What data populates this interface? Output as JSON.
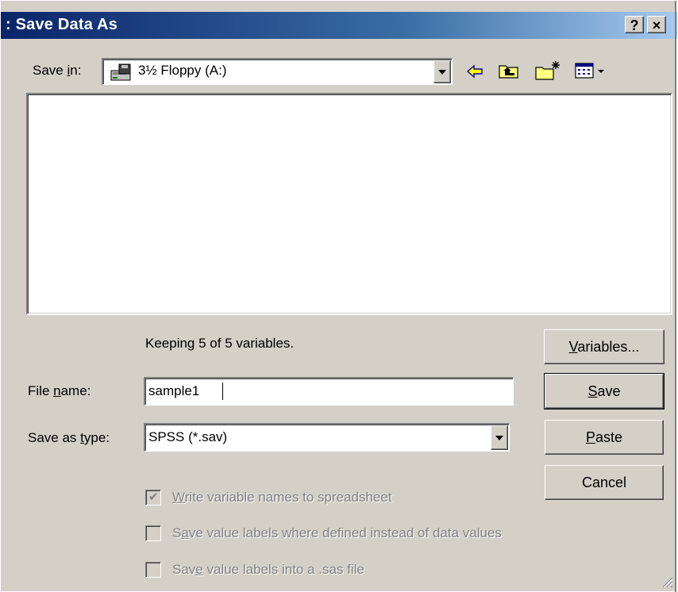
{
  "window": {
    "title": ": Save Data As",
    "help_button": "?",
    "close_button": "×"
  },
  "save_in": {
    "label_pre": "Save ",
    "label_u": "i",
    "label_post": "n:",
    "value": "3½ Floppy (A:)",
    "icon": "floppy-drive-icon"
  },
  "toolbar": {
    "icons": [
      "back-arrow-icon",
      "up-folder-icon",
      "new-folder-icon",
      "view-menu-icon"
    ]
  },
  "status": {
    "keeping": "Keeping 5 of 5 variables."
  },
  "file_name": {
    "label_pre": "File ",
    "label_u": "n",
    "label_post": "ame:",
    "value": "sample1"
  },
  "save_type": {
    "label_pre": "Save as ",
    "label_u": "t",
    "label_post": "ype:",
    "value": "SPSS (*.sav)"
  },
  "buttons": {
    "variables_u": "V",
    "variables_rest": "ariables...",
    "save_u": "S",
    "save_rest": "ave",
    "paste_u": "P",
    "paste_rest": "aste",
    "cancel": "Cancel"
  },
  "options": [
    {
      "pre": "",
      "u": "W",
      "post": "rite variable names to spreadsheet",
      "checked": true,
      "enabled": false
    },
    {
      "pre": "S",
      "u": "a",
      "post": "ve value labels where defined instead of data values",
      "checked": false,
      "enabled": false
    },
    {
      "pre": "Sav",
      "u": "e",
      "post": " value labels into a .sas file",
      "checked": false,
      "enabled": false
    }
  ],
  "colors": {
    "title_bar_start": "#0a246a",
    "title_bar_end": "#a6caf0",
    "dialog_face": "#d4d0c8"
  }
}
